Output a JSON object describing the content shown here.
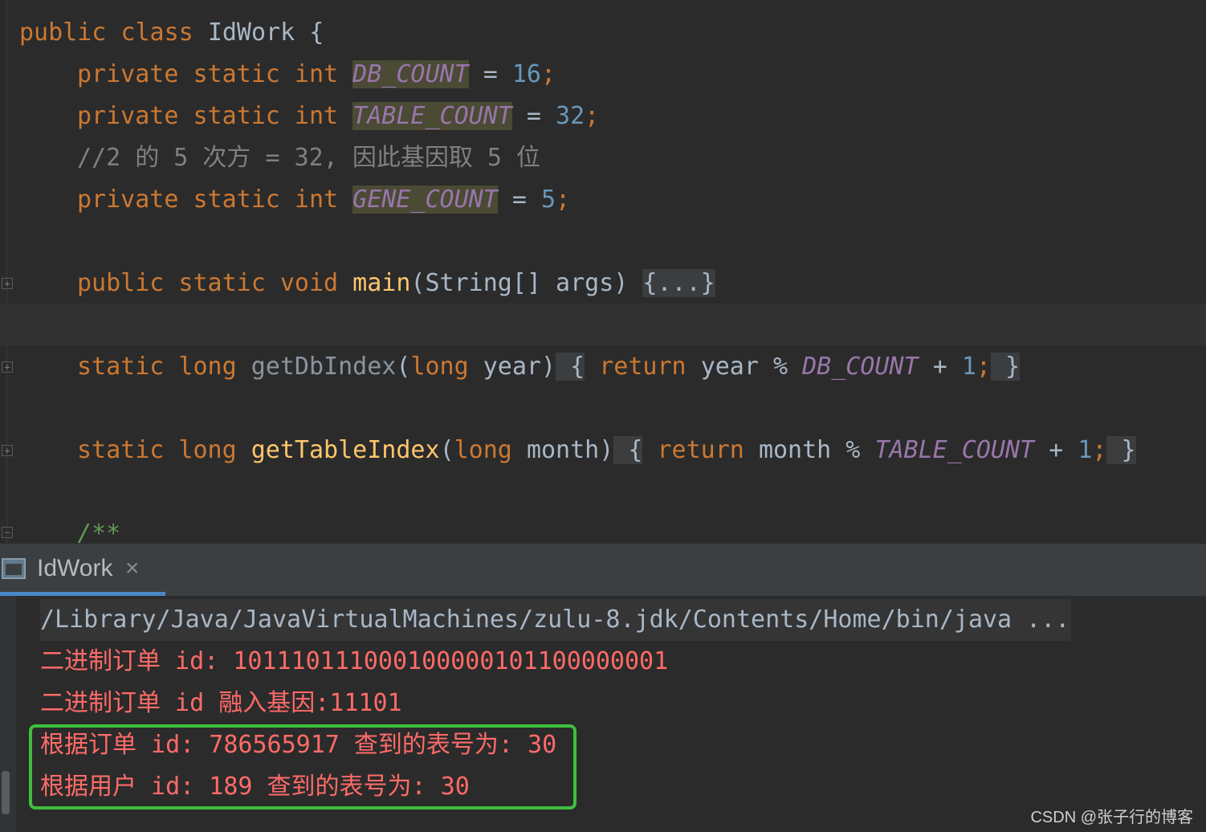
{
  "editor": {
    "l1": {
      "kw1": "public",
      "kw2": "class",
      "cls": "IdWork",
      "br": "{"
    },
    "l2": {
      "kw": "private static int",
      "name": "DB_COUNT",
      "eq": "=",
      "val": "16",
      "semi": ";"
    },
    "l3": {
      "kw": "private static int",
      "name": "TABLE_COUNT",
      "eq": "=",
      "val": "32",
      "semi": ";"
    },
    "l4": {
      "comment": "//2 的 5 次方 = 32, 因此基因取 5 位"
    },
    "l5": {
      "kw": "private static int",
      "name": "GENE_COUNT",
      "eq": "=",
      "val": "5",
      "semi": ";"
    },
    "l6": {
      "kw": "public static void",
      "fn": "main",
      "params": "(String[] args)",
      "body": "{...}"
    },
    "l7": {
      "kw": "static long",
      "fn": "getDbIndex",
      "p_open": "(",
      "p_kw": "long",
      "p_name": "year)",
      "b_open": " {",
      "ret": "return",
      "expr": "year %",
      "const": "DB_COUNT",
      "plus": "+",
      "one": "1",
      "semi": ";",
      "b_close": " }"
    },
    "l8": {
      "kw": "static long",
      "fn": "getTableIndex",
      "p_open": "(",
      "p_kw": "long",
      "p_name": "month)",
      "b_open": " {",
      "ret": "return",
      "expr": "month %",
      "const": "TABLE_COUNT",
      "plus": "+",
      "one": "1",
      "semi": ";",
      "b_close": " }"
    },
    "l9": {
      "doc": "/**"
    }
  },
  "run_tab": {
    "label": "IdWork",
    "close": "×"
  },
  "console": {
    "cmd": "/Library/Java/JavaVirtualMachines/zulu-8.jdk/Contents/Home/bin/java ...",
    "lines": [
      "二进制订单 id: 101110111000100000101100000001",
      "二进制订单 id 融入基因:11101",
      "根据订单 id: 786565917 查到的表号为: 30",
      "根据用户 id: 189 查到的表号为: 30"
    ]
  },
  "watermark": "CSDN @张子行的博客",
  "colors": {
    "keyword": "#cc7832",
    "number": "#6897bb",
    "constant": "#9876aa",
    "function": "#ffc66d",
    "output": "#ff6b68",
    "highlight_box": "#3fbf3f"
  }
}
